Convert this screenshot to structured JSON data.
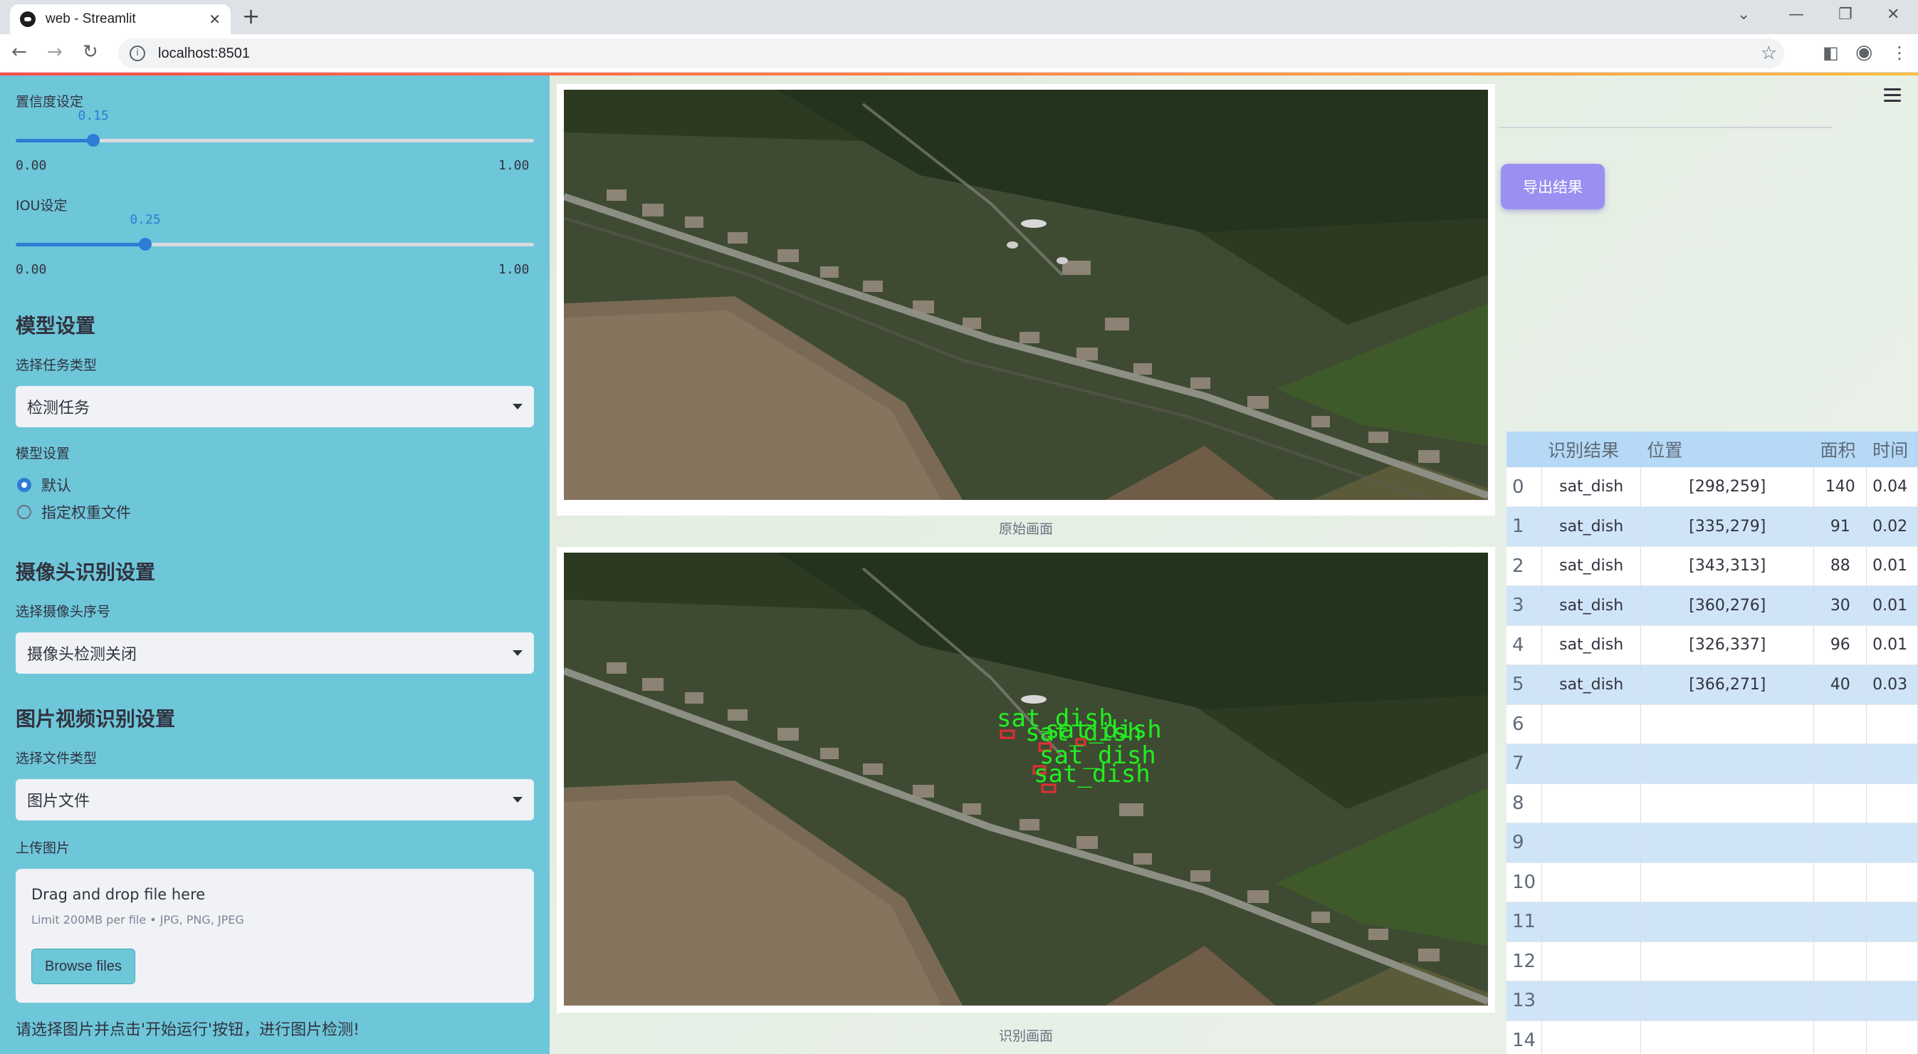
{
  "browser": {
    "tab_title": "web - Streamlit",
    "url": "localhost:8501"
  },
  "sidebar": {
    "confidence": {
      "label": "置信度设定",
      "value": "0.15",
      "min": "0.00",
      "max": "1.00",
      "fraction": 0.15
    },
    "iou": {
      "label": "IOU设定",
      "value": "0.25",
      "min": "0.00",
      "max": "1.00",
      "fraction": 0.25
    },
    "model_heading": "模型设置",
    "task_label": "选择任务类型",
    "task_value": "检测任务",
    "model_label": "模型设置",
    "model_options": [
      "默认",
      "指定权重文件"
    ],
    "model_selected": 0,
    "camera_heading": "摄像头识别设置",
    "camera_label": "选择摄像头序号",
    "camera_value": "摄像头检测关闭",
    "media_heading": "图片视频识别设置",
    "file_type_label": "选择文件类型",
    "file_type_value": "图片文件",
    "upload_label": "上传图片",
    "upload_main": "Drag and drop file here",
    "upload_limit": "Limit 200MB per file • JPG, PNG, JPEG",
    "browse_label": "Browse files",
    "note": "请选择图片并点击'开始运行'按钮，进行图片检测!"
  },
  "main": {
    "original_caption": "原始画面",
    "result_caption": "识别画面",
    "detections_overlay": [
      "sat_dish",
      "sat_dish",
      "sat_dish",
      "sat_dish",
      "sat_dish"
    ],
    "export_label": "导出结果"
  },
  "table": {
    "headers": [
      "",
      "识别结果",
      "位置",
      "面积",
      "时间"
    ],
    "rows": [
      {
        "idx": "0",
        "result": "sat_dish",
        "pos": "[298,259]",
        "area": "140",
        "time": "0.04"
      },
      {
        "idx": "1",
        "result": "sat_dish",
        "pos": "[335,279]",
        "area": "91",
        "time": "0.02"
      },
      {
        "idx": "2",
        "result": "sat_dish",
        "pos": "[343,313]",
        "area": "88",
        "time": "0.01"
      },
      {
        "idx": "3",
        "result": "sat_dish",
        "pos": "[360,276]",
        "area": "30",
        "time": "0.01"
      },
      {
        "idx": "4",
        "result": "sat_dish",
        "pos": "[326,337]",
        "area": "96",
        "time": "0.01"
      },
      {
        "idx": "5",
        "result": "sat_dish",
        "pos": "[366,271]",
        "area": "40",
        "time": "0.03"
      },
      {
        "idx": "6",
        "result": "",
        "pos": "",
        "area": "",
        "time": ""
      },
      {
        "idx": "7",
        "result": "",
        "pos": "",
        "area": "",
        "time": ""
      },
      {
        "idx": "8",
        "result": "",
        "pos": "",
        "area": "",
        "time": ""
      },
      {
        "idx": "9",
        "result": "",
        "pos": "",
        "area": "",
        "time": ""
      },
      {
        "idx": "10",
        "result": "",
        "pos": "",
        "area": "",
        "time": ""
      },
      {
        "idx": "11",
        "result": "",
        "pos": "",
        "area": "",
        "time": ""
      },
      {
        "idx": "12",
        "result": "",
        "pos": "",
        "area": "",
        "time": ""
      },
      {
        "idx": "13",
        "result": "",
        "pos": "",
        "area": "",
        "time": ""
      },
      {
        "idx": "14",
        "result": "",
        "pos": "",
        "area": "",
        "time": ""
      }
    ]
  },
  "colors": {
    "sidebar_bg": "#6ec6d9",
    "accent": "#2e7cd6",
    "export_button": "#9b8ff2",
    "detection_label": "#22ee22",
    "table_header": "#b5d9f6"
  }
}
